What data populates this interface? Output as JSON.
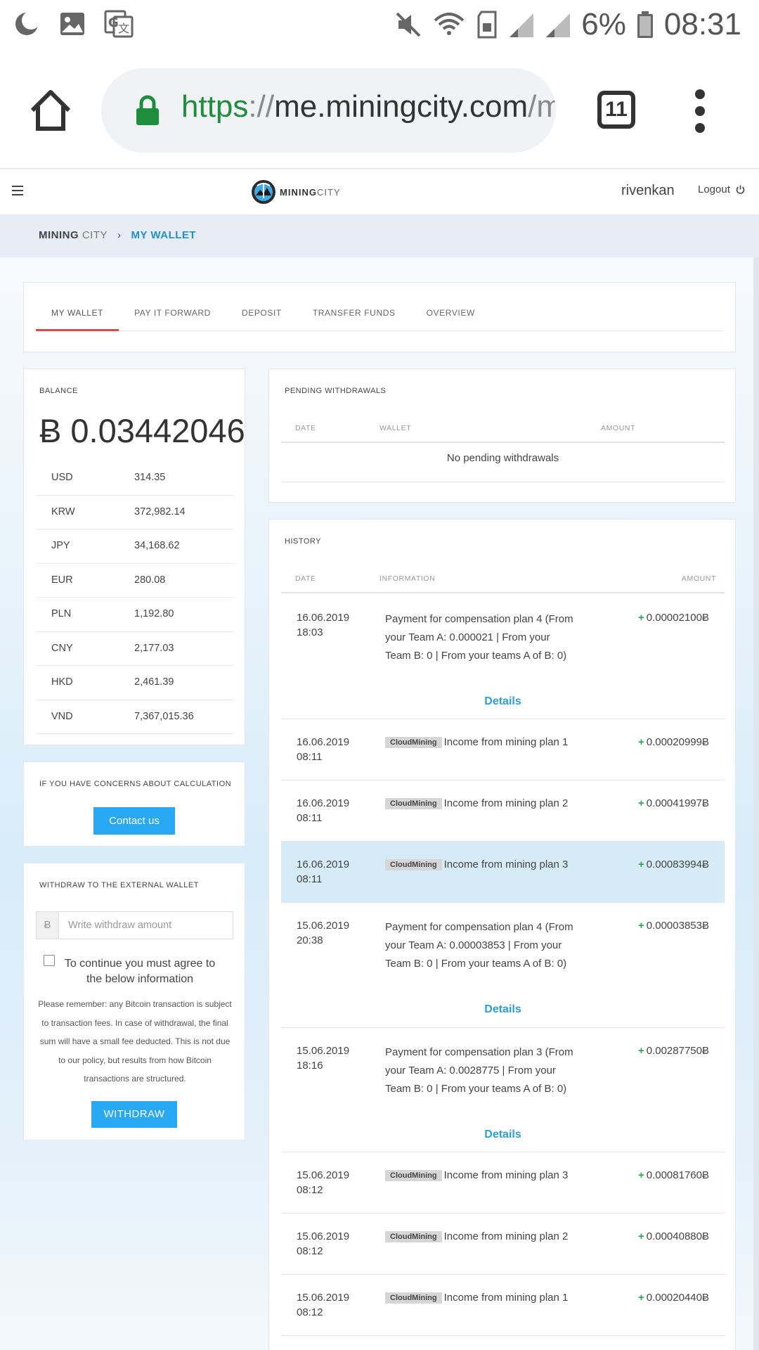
{
  "status_bar": {
    "battery_text": "6%",
    "time": "08:31",
    "icons": [
      "moon-icon",
      "image-icon",
      "translate-icon",
      "mute-icon",
      "wifi-icon",
      "sim-icon",
      "signal-icon",
      "signal-icon",
      "battery-icon"
    ]
  },
  "browser": {
    "url_scheme": "https",
    "url_sep": "://",
    "url_host": "me.miningcity.com",
    "url_path": "/my",
    "tab_count": "11",
    "icons": [
      "home-icon",
      "lock-icon",
      "tab-switcher-icon",
      "more-vert-icon"
    ]
  },
  "header": {
    "logo_text_bold": "MINING",
    "logo_text_light": "CITY",
    "username": "rivenkan",
    "logout_label": "Logout"
  },
  "breadcrumb": {
    "root_bold": "MINING",
    "root_light": " CITY",
    "separator": "›",
    "current": "MY WALLET"
  },
  "tabs": [
    {
      "label": "MY WALLET",
      "active": true
    },
    {
      "label": "PAY IT FORWARD",
      "active": false
    },
    {
      "label": "DEPOSIT",
      "active": false
    },
    {
      "label": "TRANSFER FUNDS",
      "active": false
    },
    {
      "label": "OVERVIEW",
      "active": false
    }
  ],
  "balance": {
    "heading": "BALANCE",
    "amount": "Ƀ 0.03442046",
    "currencies": [
      {
        "code": "USD",
        "value": "314.35"
      },
      {
        "code": "KRW",
        "value": "372,982.14"
      },
      {
        "code": "JPY",
        "value": "34,168.62"
      },
      {
        "code": "EUR",
        "value": "280.08"
      },
      {
        "code": "PLN",
        "value": "1,192.80"
      },
      {
        "code": "CNY",
        "value": "2,177.03"
      },
      {
        "code": "HKD",
        "value": "2,461.39"
      },
      {
        "code": "VND",
        "value": "7,367,015.36"
      }
    ]
  },
  "concerns": {
    "heading": "IF YOU HAVE CONCERNS ABOUT CALCULATION",
    "button": "Contact us"
  },
  "withdraw": {
    "heading": "WITHDRAW TO THE EXTERNAL WALLET",
    "prefix": "Ƀ",
    "placeholder": "Write withdraw amount",
    "agree_label": "To continue you must agree to the below information",
    "note": "Please remember: any Bitcoin transaction is subject to transaction fees. In case of withdrawal, the final sum will have a small fee deducted. This is not due to our policy, but results from how Bitcoin transactions are structured.",
    "button": "WITHDRAW"
  },
  "pending": {
    "heading": "PENDING WITHDRAWALS",
    "columns": [
      "DATE",
      "WALLET",
      "AMOUNT"
    ],
    "empty_text": "No pending withdrawals"
  },
  "history": {
    "heading": "HISTORY",
    "columns": [
      "DATE",
      "INFORMATION",
      "AMOUNT"
    ],
    "details_label": "Details",
    "rows": [
      {
        "date": "16.06.2019",
        "time": "18:03",
        "badge": "",
        "info": "Payment for compensation plan 4 (From your Team A: 0.000021 | From your Team B: 0 | From your teams A of B: 0)",
        "sign": "+",
        "amount": "0.00002100Ƀ",
        "details": true
      },
      {
        "date": "16.06.2019",
        "time": "08:11",
        "badge": "CloudMining",
        "info": "Income from mining plan 1",
        "sign": "+",
        "amount": "0.00020999Ƀ",
        "details": false
      },
      {
        "date": "16.06.2019",
        "time": "08:11",
        "badge": "CloudMining",
        "info": "Income from mining plan 2",
        "sign": "+",
        "amount": "0.00041997Ƀ",
        "details": false
      },
      {
        "date": "16.06.2019",
        "time": "08:11",
        "badge": "CloudMining",
        "info": "Income from mining plan 3",
        "sign": "+",
        "amount": "0.00083994Ƀ",
        "details": false
      },
      {
        "date": "15.06.2019",
        "time": "20:38",
        "badge": "",
        "info": "Payment for compensation plan 4 (From your Team A: 0.00003853 | From your Team B: 0 | From your teams A of B: 0)",
        "sign": "+",
        "amount": "0.00003853Ƀ",
        "details": true
      },
      {
        "date": "15.06.2019",
        "time": "18:16",
        "badge": "",
        "info": "Payment for compensation plan 3 (From your Team A: 0.0028775 | From your Team B: 0 | From your teams A of B: 0)",
        "sign": "+",
        "amount": "0.00287750Ƀ",
        "details": true
      },
      {
        "date": "15.06.2019",
        "time": "08:12",
        "badge": "CloudMining",
        "info": "Income from mining plan 3",
        "sign": "+",
        "amount": "0.00081760Ƀ",
        "details": false
      },
      {
        "date": "15.06.2019",
        "time": "08:12",
        "badge": "CloudMining",
        "info": "Income from mining plan 2",
        "sign": "+",
        "amount": "0.00040880Ƀ",
        "details": false
      },
      {
        "date": "15.06.2019",
        "time": "08:12",
        "badge": "CloudMining",
        "info": "Income from mining plan 1",
        "sign": "+",
        "amount": "0.00020440Ƀ",
        "details": false
      }
    ]
  },
  "colors": {
    "accent": "#29a9f4",
    "tab_active_underline": "#e04848",
    "breadcrumb_current": "#1f8fcf",
    "positive": "#2aa44d",
    "row_highlight": "#d5ebf8"
  }
}
